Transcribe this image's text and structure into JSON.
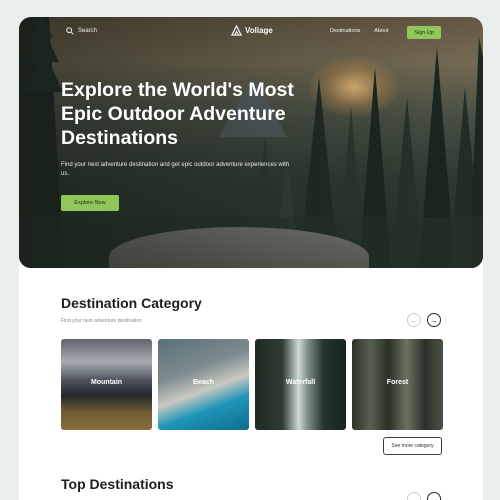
{
  "nav": {
    "search_label": "Search",
    "brand": "Voliage",
    "links": [
      "Destinations",
      "About"
    ],
    "signup_label": "Sign Up"
  },
  "hero": {
    "title": "Explore the World's Most Epic Outdoor Adventure Destinations",
    "subtitle": "Find your next adventure destination and get epic outdoor adventure experiences with us.",
    "cta_label": "Explore Now"
  },
  "category": {
    "title": "Destination Category",
    "subtitle": "Find your next adventure destination",
    "cards": [
      {
        "label": "Mountain"
      },
      {
        "label": "Beach"
      },
      {
        "label": "Waterfall"
      },
      {
        "label": "Forest"
      }
    ],
    "more_label": "See more category"
  },
  "top": {
    "title": "Top Destinations"
  },
  "colors": {
    "accent": "#8fc75a",
    "background": "#eaeeee",
    "text": "#1e1e1e"
  },
  "icons": {
    "search": "search-icon",
    "logo": "logo-icon",
    "prev": "arrow-left-icon",
    "next": "arrow-right-icon"
  }
}
